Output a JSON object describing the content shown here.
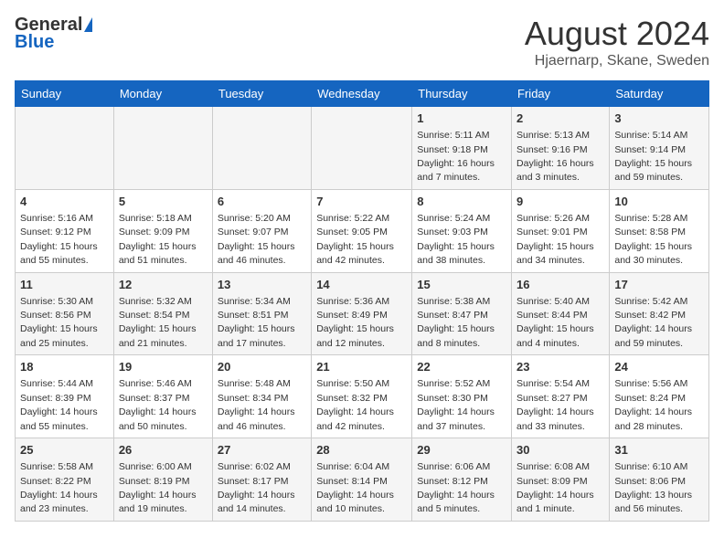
{
  "header": {
    "logo_general": "General",
    "logo_blue": "Blue",
    "title": "August 2024",
    "subtitle": "Hjaernarp, Skane, Sweden"
  },
  "days_of_week": [
    "Sunday",
    "Monday",
    "Tuesday",
    "Wednesday",
    "Thursday",
    "Friday",
    "Saturday"
  ],
  "weeks": [
    [
      {
        "day": "",
        "info": ""
      },
      {
        "day": "",
        "info": ""
      },
      {
        "day": "",
        "info": ""
      },
      {
        "day": "",
        "info": ""
      },
      {
        "day": "1",
        "info": "Sunrise: 5:11 AM\nSunset: 9:18 PM\nDaylight: 16 hours\nand 7 minutes."
      },
      {
        "day": "2",
        "info": "Sunrise: 5:13 AM\nSunset: 9:16 PM\nDaylight: 16 hours\nand 3 minutes."
      },
      {
        "day": "3",
        "info": "Sunrise: 5:14 AM\nSunset: 9:14 PM\nDaylight: 15 hours\nand 59 minutes."
      }
    ],
    [
      {
        "day": "4",
        "info": "Sunrise: 5:16 AM\nSunset: 9:12 PM\nDaylight: 15 hours\nand 55 minutes."
      },
      {
        "day": "5",
        "info": "Sunrise: 5:18 AM\nSunset: 9:09 PM\nDaylight: 15 hours\nand 51 minutes."
      },
      {
        "day": "6",
        "info": "Sunrise: 5:20 AM\nSunset: 9:07 PM\nDaylight: 15 hours\nand 46 minutes."
      },
      {
        "day": "7",
        "info": "Sunrise: 5:22 AM\nSunset: 9:05 PM\nDaylight: 15 hours\nand 42 minutes."
      },
      {
        "day": "8",
        "info": "Sunrise: 5:24 AM\nSunset: 9:03 PM\nDaylight: 15 hours\nand 38 minutes."
      },
      {
        "day": "9",
        "info": "Sunrise: 5:26 AM\nSunset: 9:01 PM\nDaylight: 15 hours\nand 34 minutes."
      },
      {
        "day": "10",
        "info": "Sunrise: 5:28 AM\nSunset: 8:58 PM\nDaylight: 15 hours\nand 30 minutes."
      }
    ],
    [
      {
        "day": "11",
        "info": "Sunrise: 5:30 AM\nSunset: 8:56 PM\nDaylight: 15 hours\nand 25 minutes."
      },
      {
        "day": "12",
        "info": "Sunrise: 5:32 AM\nSunset: 8:54 PM\nDaylight: 15 hours\nand 21 minutes."
      },
      {
        "day": "13",
        "info": "Sunrise: 5:34 AM\nSunset: 8:51 PM\nDaylight: 15 hours\nand 17 minutes."
      },
      {
        "day": "14",
        "info": "Sunrise: 5:36 AM\nSunset: 8:49 PM\nDaylight: 15 hours\nand 12 minutes."
      },
      {
        "day": "15",
        "info": "Sunrise: 5:38 AM\nSunset: 8:47 PM\nDaylight: 15 hours\nand 8 minutes."
      },
      {
        "day": "16",
        "info": "Sunrise: 5:40 AM\nSunset: 8:44 PM\nDaylight: 15 hours\nand 4 minutes."
      },
      {
        "day": "17",
        "info": "Sunrise: 5:42 AM\nSunset: 8:42 PM\nDaylight: 14 hours\nand 59 minutes."
      }
    ],
    [
      {
        "day": "18",
        "info": "Sunrise: 5:44 AM\nSunset: 8:39 PM\nDaylight: 14 hours\nand 55 minutes."
      },
      {
        "day": "19",
        "info": "Sunrise: 5:46 AM\nSunset: 8:37 PM\nDaylight: 14 hours\nand 50 minutes."
      },
      {
        "day": "20",
        "info": "Sunrise: 5:48 AM\nSunset: 8:34 PM\nDaylight: 14 hours\nand 46 minutes."
      },
      {
        "day": "21",
        "info": "Sunrise: 5:50 AM\nSunset: 8:32 PM\nDaylight: 14 hours\nand 42 minutes."
      },
      {
        "day": "22",
        "info": "Sunrise: 5:52 AM\nSunset: 8:30 PM\nDaylight: 14 hours\nand 37 minutes."
      },
      {
        "day": "23",
        "info": "Sunrise: 5:54 AM\nSunset: 8:27 PM\nDaylight: 14 hours\nand 33 minutes."
      },
      {
        "day": "24",
        "info": "Sunrise: 5:56 AM\nSunset: 8:24 PM\nDaylight: 14 hours\nand 28 minutes."
      }
    ],
    [
      {
        "day": "25",
        "info": "Sunrise: 5:58 AM\nSunset: 8:22 PM\nDaylight: 14 hours\nand 23 minutes."
      },
      {
        "day": "26",
        "info": "Sunrise: 6:00 AM\nSunset: 8:19 PM\nDaylight: 14 hours\nand 19 minutes."
      },
      {
        "day": "27",
        "info": "Sunrise: 6:02 AM\nSunset: 8:17 PM\nDaylight: 14 hours\nand 14 minutes."
      },
      {
        "day": "28",
        "info": "Sunrise: 6:04 AM\nSunset: 8:14 PM\nDaylight: 14 hours\nand 10 minutes."
      },
      {
        "day": "29",
        "info": "Sunrise: 6:06 AM\nSunset: 8:12 PM\nDaylight: 14 hours\nand 5 minutes."
      },
      {
        "day": "30",
        "info": "Sunrise: 6:08 AM\nSunset: 8:09 PM\nDaylight: 14 hours\nand 1 minute."
      },
      {
        "day": "31",
        "info": "Sunrise: 6:10 AM\nSunset: 8:06 PM\nDaylight: 13 hours\nand 56 minutes."
      }
    ]
  ]
}
